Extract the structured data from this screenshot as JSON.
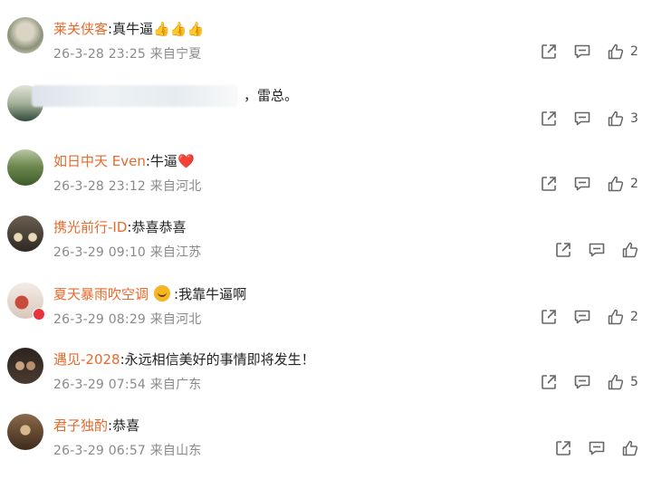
{
  "comments": [
    {
      "username": "莱关侠客",
      "text": "真牛逼",
      "emoji": "👍👍👍",
      "date": "26-3-28 23:25",
      "location": "来自宁夏",
      "likes": "2",
      "avatar_colors": [
        "#e8e4d8",
        "#8a8f78"
      ]
    },
    {
      "username": "",
      "text": "，雷总。",
      "date": "",
      "location": "",
      "likes": "3",
      "avatar_colors": [
        "#cfd8c4",
        "#3d5a48"
      ]
    },
    {
      "username": "如日中天 Even",
      "text": "牛逼",
      "emoji": "❤️",
      "date": "26-3-28 23:12",
      "location": "来自河北",
      "likes": "2",
      "avatar_colors": [
        "#8ea86e",
        "#3f5a2e"
      ]
    },
    {
      "username": "携光前行-ID",
      "text": "恭喜恭喜",
      "date": "26-3-29 09:10",
      "location": "来自江苏",
      "likes": "",
      "avatar_colors": [
        "#b9aa93",
        "#3a332b"
      ]
    },
    {
      "username": "夏天暴雨吹空调",
      "text": "我靠牛逼啊",
      "date": "26-3-29 08:29",
      "location": "来自河北",
      "likes": "2",
      "avatar_colors": [
        "#f0e6e0",
        "#c44a3a"
      ]
    },
    {
      "username": "遇见-2028",
      "text": "永远相信美好的事情即将发生！",
      "date": "26-3-29 07:54",
      "location": "来自广东",
      "likes": "5",
      "avatar_colors": [
        "#2e2723",
        "#8a6a4e"
      ]
    },
    {
      "username": "君子独酌",
      "text": "恭喜",
      "date": "26-3-29 06:57",
      "location": "来自山东",
      "likes": "",
      "avatar_colors": [
        "#c2b096",
        "#4a3222"
      ]
    }
  ],
  "icons": {
    "share": "share-icon",
    "comment": "comment-icon",
    "like": "thumbs-up-icon"
  }
}
